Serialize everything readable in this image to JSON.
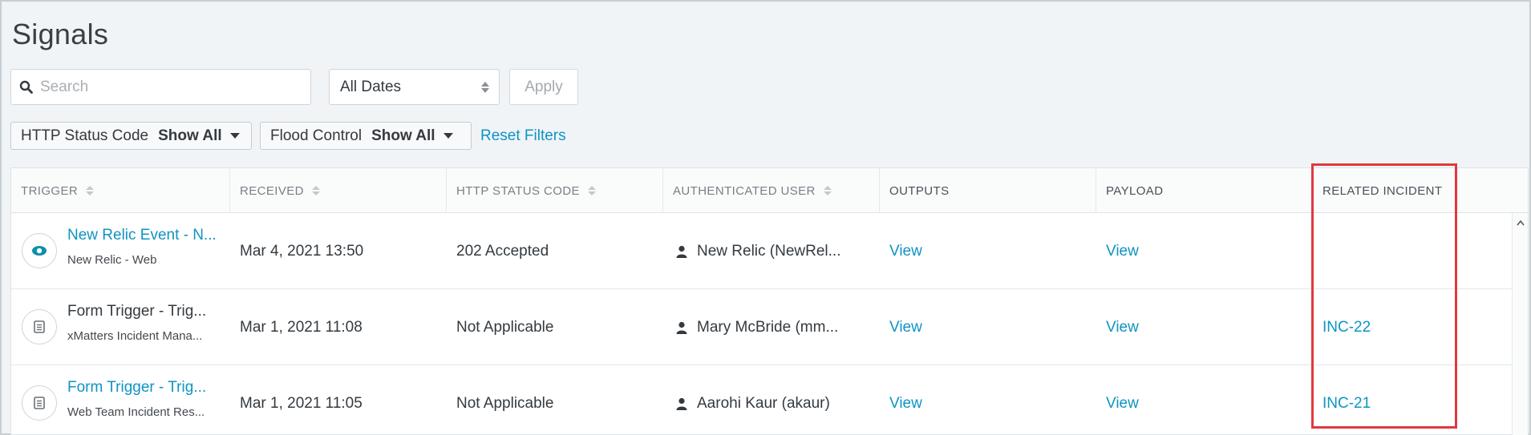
{
  "page": {
    "title": "Signals"
  },
  "search": {
    "placeholder": "Search",
    "value": ""
  },
  "date_filter": {
    "selected": "All Dates"
  },
  "apply_label": "Apply",
  "filters": [
    {
      "label": "HTTP Status Code",
      "value": "Show All"
    },
    {
      "label": "Flood Control",
      "value": "Show All"
    }
  ],
  "reset_label": "Reset Filters",
  "table": {
    "columns": [
      {
        "label": "TRIGGER",
        "sortable": true
      },
      {
        "label": "RECEIVED",
        "sortable": true
      },
      {
        "label": "HTTP STATUS CODE",
        "sortable": true
      },
      {
        "label": "AUTHENTICATED USER",
        "sortable": true
      },
      {
        "label": "OUTPUTS",
        "sortable": false
      },
      {
        "label": "PAYLOAD",
        "sortable": false
      },
      {
        "label": "RELATED INCIDENT",
        "sortable": false
      }
    ],
    "rows": [
      {
        "trigger": "New Relic Event - N...",
        "trigger_link": true,
        "source": "New Relic - Web",
        "icon": "eye-icon",
        "received": "Mar 4, 2021 13:50",
        "status": "202 Accepted",
        "user": "New Relic (NewRel...",
        "outputs": "View",
        "payload": "View",
        "incident": ""
      },
      {
        "trigger": "Form Trigger - Trig...",
        "trigger_link": false,
        "source": "xMatters Incident Mana...",
        "icon": "form-icon",
        "received": "Mar 1, 2021 11:08",
        "status": "Not Applicable",
        "user": "Mary McBride (mm...",
        "outputs": "View",
        "payload": "View",
        "incident": "INC-22"
      },
      {
        "trigger": "Form Trigger - Trig...",
        "trigger_link": true,
        "source": "Web Team Incident Res...",
        "icon": "form-icon",
        "received": "Mar 1, 2021 11:05",
        "status": "Not Applicable",
        "user": "Aarohi Kaur (akaur)",
        "outputs": "View",
        "payload": "View",
        "incident": "INC-21"
      }
    ]
  },
  "colors": {
    "link": "#0e94c2",
    "highlight": "#e0393e",
    "background": "#f1f4f7"
  }
}
